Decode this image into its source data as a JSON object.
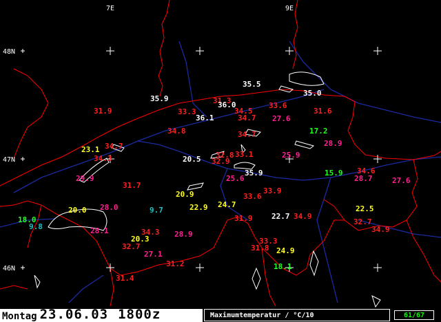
{
  "header": {
    "lon_labels": [
      "7E",
      "9E"
    ]
  },
  "lat_labels": [
    "48N",
    "47N",
    "46N"
  ],
  "footer": {
    "weekday": "Montag",
    "date": "23.06.03",
    "time": "1800z",
    "parameter": "Maximumtemperatur / °C/10",
    "page": "61/67"
  },
  "colors": {
    "white": "#ffffff",
    "red": "#ff2020",
    "pink": "#ff2090",
    "yellow": "#ffff20",
    "green": "#20ff20",
    "cyan": "#20c0c0",
    "border": "#ff0000",
    "river": "#1a2aa0"
  },
  "stations": [
    {
      "value": "35.5",
      "color": "white"
    },
    {
      "value": "35.0",
      "color": "white"
    },
    {
      "value": "35.9",
      "color": "white"
    },
    {
      "value": "31.3",
      "color": "red"
    },
    {
      "value": "36.0",
      "color": "white"
    },
    {
      "value": "33.6",
      "color": "red"
    },
    {
      "value": "31.9",
      "color": "red"
    },
    {
      "value": "33.3",
      "color": "red"
    },
    {
      "value": "34.5",
      "color": "red"
    },
    {
      "value": "31.6",
      "color": "red"
    },
    {
      "value": "36.1",
      "color": "white"
    },
    {
      "value": "34.7",
      "color": "red"
    },
    {
      "value": "27.6",
      "color": "pink"
    },
    {
      "value": "34.8",
      "color": "red"
    },
    {
      "value": "17.2",
      "color": "green"
    },
    {
      "value": "34.7",
      "color": "red"
    },
    {
      "value": "28.9",
      "color": "pink"
    },
    {
      "value": "23.1",
      "color": "yellow"
    },
    {
      "value": "34.7",
      "color": "red"
    },
    {
      "value": "33.1",
      "color": "red"
    },
    {
      "value": "34.3",
      "color": "red"
    },
    {
      "value": "32.8",
      "color": "red"
    },
    {
      "value": "25.9",
      "color": "pink"
    },
    {
      "value": "20.5",
      "color": "white"
    },
    {
      "value": "32.9",
      "color": "red"
    },
    {
      "value": "35.9",
      "color": "white"
    },
    {
      "value": "15.9",
      "color": "green"
    },
    {
      "value": "34.6",
      "color": "red"
    },
    {
      "value": "29.9",
      "color": "pink"
    },
    {
      "value": "25.6",
      "color": "pink"
    },
    {
      "value": "28.7",
      "color": "pink"
    },
    {
      "value": "27.6",
      "color": "pink"
    },
    {
      "value": "31.7",
      "color": "red"
    },
    {
      "value": "33.9",
      "color": "red"
    },
    {
      "value": "20.9",
      "color": "yellow"
    },
    {
      "value": "33.6",
      "color": "red"
    },
    {
      "value": "20.0",
      "color": "yellow"
    },
    {
      "value": "28.0",
      "color": "pink"
    },
    {
      "value": "9.7",
      "color": "cyan"
    },
    {
      "value": "22.9",
      "color": "yellow"
    },
    {
      "value": "24.7",
      "color": "yellow"
    },
    {
      "value": "22.5",
      "color": "yellow"
    },
    {
      "value": "18.0",
      "color": "green"
    },
    {
      "value": "31.9",
      "color": "red"
    },
    {
      "value": "22.7",
      "color": "white"
    },
    {
      "value": "34.9",
      "color": "red"
    },
    {
      "value": "9.8",
      "color": "cyan"
    },
    {
      "value": "32.7",
      "color": "red"
    },
    {
      "value": "28.1",
      "color": "pink"
    },
    {
      "value": "34.3",
      "color": "red"
    },
    {
      "value": "28.9",
      "color": "pink"
    },
    {
      "value": "34.9",
      "color": "red"
    },
    {
      "value": "20.3",
      "color": "yellow"
    },
    {
      "value": "33.3",
      "color": "red"
    },
    {
      "value": "32.7",
      "color": "red"
    },
    {
      "value": "31.8",
      "color": "red"
    },
    {
      "value": "24.9",
      "color": "yellow"
    },
    {
      "value": "27.1",
      "color": "pink"
    },
    {
      "value": "31.2",
      "color": "red"
    },
    {
      "value": "18.1",
      "color": "green"
    },
    {
      "value": "31.4",
      "color": "red"
    }
  ]
}
